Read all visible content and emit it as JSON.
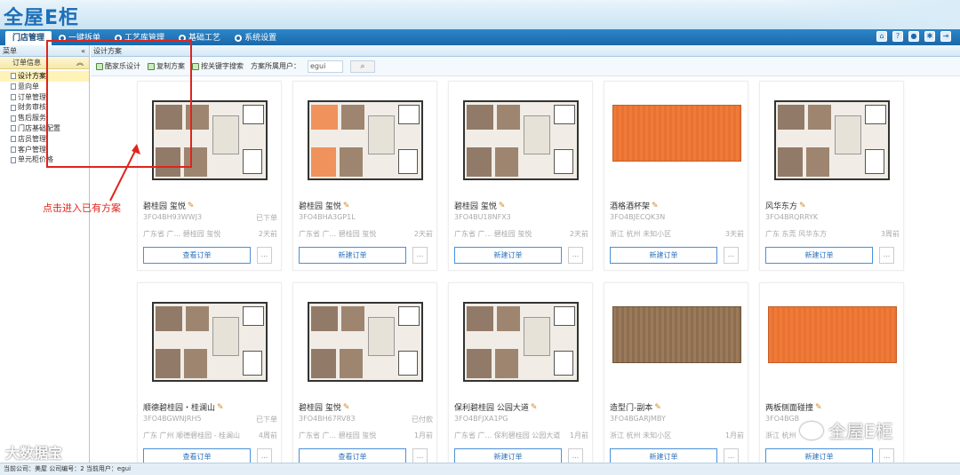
{
  "app": {
    "logo": "全屋E柜"
  },
  "nav": {
    "items": [
      {
        "label": "门店管理",
        "active": true
      },
      {
        "label": "一键拆单"
      },
      {
        "label": "工艺库管理"
      },
      {
        "label": "基础工艺"
      },
      {
        "label": "系统设置"
      }
    ],
    "icons": [
      "home-icon",
      "help-icon",
      "user-icon",
      "settings-icon",
      "exit-icon"
    ]
  },
  "sidebar": {
    "header": "菜单",
    "section": "订单信息",
    "items": [
      "设计方案",
      "意向单",
      "订单管理",
      "财务审核",
      "售后服务",
      "门店基础配置",
      "店员管理",
      "客户管理",
      "单元柜价格"
    ]
  },
  "main": {
    "breadcrumb": "设计方案",
    "toolbar": {
      "btn_design": "酷家乐设计",
      "btn_copy": "复制方案",
      "btn_search": "按关键字搜索",
      "owner_label": "方案所属用户：",
      "owner_value": "egui"
    },
    "cards": [
      {
        "title": "碧桂园 玺悦",
        "code": "3FO4BH93WWJ3",
        "status": "已下单",
        "location": "广东省 广... 碧桂园 玺悦",
        "time": "2天前",
        "button": "查看订单",
        "thumb": "plan"
      },
      {
        "title": "碧桂园 玺悦",
        "code": "3FO4BHA3GP1L",
        "status": "",
        "location": "广东省 广... 碧桂园 玺悦",
        "time": "2天前",
        "button": "新建订单",
        "thumb": "plan-color"
      },
      {
        "title": "碧桂园 玺悦",
        "code": "3FO4BU18NFX3",
        "status": "",
        "location": "广东省 广... 碧桂园 玺悦",
        "time": "2天前",
        "button": "新建订单",
        "thumb": "plan"
      },
      {
        "title": "酒格酒杯架",
        "code": "3FO4BJECQK3N",
        "status": "",
        "location": "浙江 杭州 未知小区",
        "time": "3天前",
        "button": "新建订单",
        "thumb": "orange"
      },
      {
        "title": "风华东方",
        "code": "3FO4BRQRRYK",
        "status": "",
        "location": "广东 东莞 风华东方",
        "time": "3周前",
        "button": "新建订单",
        "thumb": "plan"
      },
      {
        "title": "顺德碧桂园・桂澜山",
        "code": "3FO4BGWNJRH5",
        "status": "已下单",
        "location": "广东 广州 顺德碧桂园 - 桂澜山",
        "time": "4周前",
        "button": "查看订单",
        "thumb": "plan"
      },
      {
        "title": "碧桂园 玺悦",
        "code": "3FO4BH67RV83",
        "status": "已付款",
        "location": "广东省 广... 碧桂园 玺悦",
        "time": "1月前",
        "button": "查看订单",
        "thumb": "plan"
      },
      {
        "title": "保利碧桂园 公园大道",
        "code": "3FO4BFJXA1PG",
        "status": "",
        "location": "广东省 广... 保利碧桂园 公园大道",
        "time": "1月前",
        "button": "新建订单",
        "thumb": "plan"
      },
      {
        "title": "造型门-副本",
        "code": "3FO4BGARJMBY",
        "status": "",
        "location": "浙江 杭州 未知小区",
        "time": "1月前",
        "button": "新建订单",
        "thumb": "wood"
      },
      {
        "title": "两板侧面碰撞",
        "code": "3FO4BGB",
        "status": "",
        "location": "浙江 杭州",
        "time": "",
        "button": "新建订单",
        "thumb": "orange"
      }
    ],
    "more_label": "..."
  },
  "annotation": {
    "text": "点击进入已有方案",
    "color": "#e0241b"
  },
  "status_bar": {
    "text": "当前公司：美屋   公司编号：2   当前用户：egui"
  },
  "watermarks": {
    "left": "大数据宝",
    "right": "全屋E柜"
  },
  "colors": {
    "nav": "#1a68a9",
    "accent": "#4a90d9",
    "orange": "#f07a3a",
    "wood": "#9a7a5a"
  }
}
